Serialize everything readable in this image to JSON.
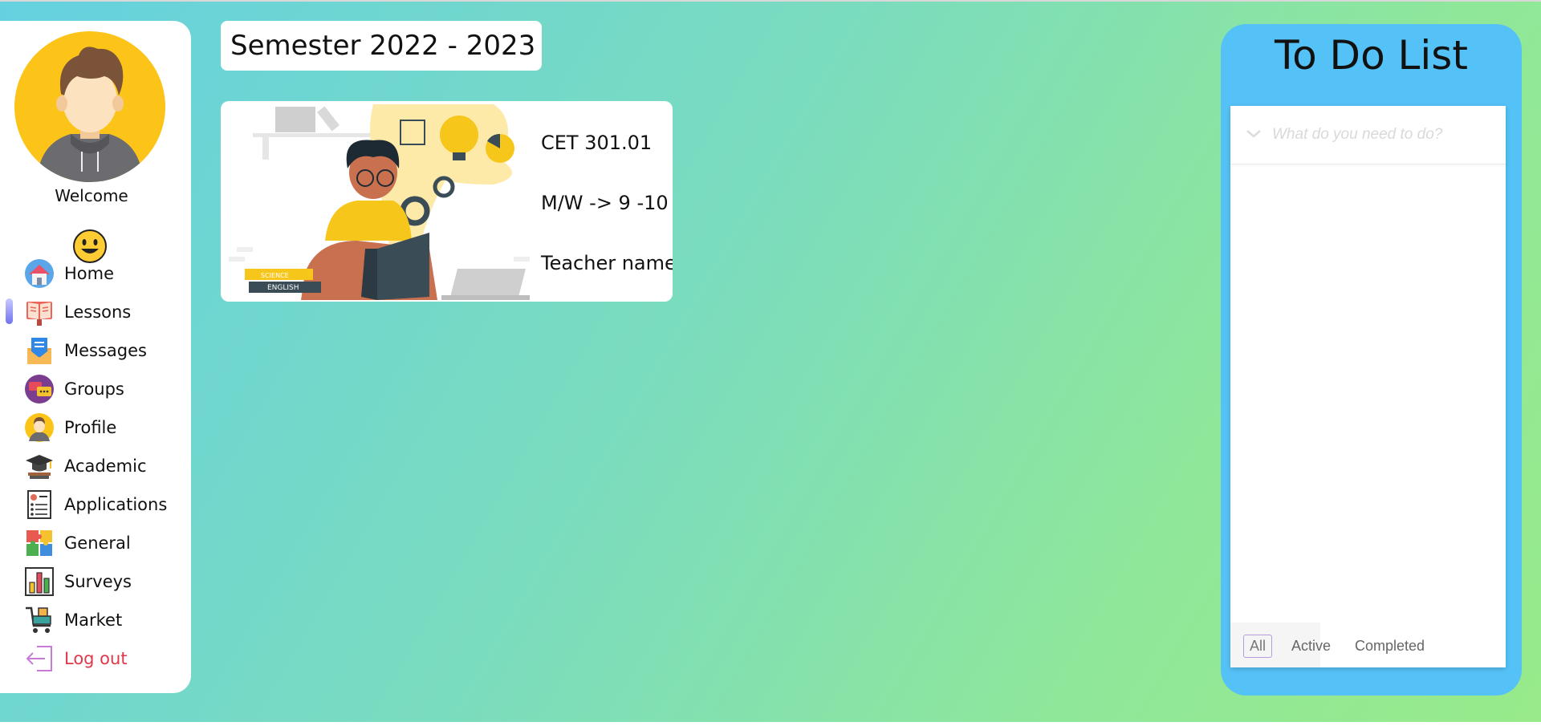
{
  "sidebar": {
    "welcome": "Welcome",
    "items": [
      {
        "label": "Home"
      },
      {
        "label": "Lessons"
      },
      {
        "label": "Messages"
      },
      {
        "label": "Groups"
      },
      {
        "label": "Profile"
      },
      {
        "label": "Academic"
      },
      {
        "label": "Applications"
      },
      {
        "label": "General"
      },
      {
        "label": "Surveys"
      },
      {
        "label": "Market"
      },
      {
        "label": "Log out"
      }
    ],
    "active": "Lessons"
  },
  "main": {
    "semester": "Semester 2022 - 2023",
    "course": {
      "code": "CET 301.01",
      "schedule": "M/W -> 9 -10",
      "teacher": "Teacher name",
      "book_labels": [
        "SCIENCE",
        "ENGLISH"
      ]
    }
  },
  "todo": {
    "title": "To Do List",
    "placeholder": "What do you need to do?",
    "filters": [
      "All",
      "Active",
      "Completed"
    ],
    "selected_filter": "All"
  },
  "colors": {
    "todo_panel": "#55c2f7",
    "logout": "#e0384b",
    "active_indicator": "#6e73f0"
  }
}
